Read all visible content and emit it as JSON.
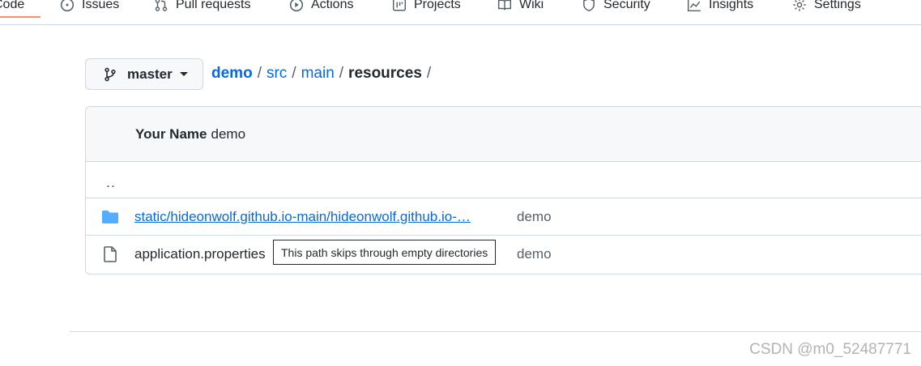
{
  "tabs": [
    {
      "label": "Code",
      "icon": "code-icon",
      "selected": true
    },
    {
      "label": "Issues",
      "icon": "issue-icon"
    },
    {
      "label": "Pull requests",
      "icon": "pull-request-icon"
    },
    {
      "label": "Actions",
      "icon": "play-icon"
    },
    {
      "label": "Projects",
      "icon": "project-icon"
    },
    {
      "label": "Wiki",
      "icon": "book-icon"
    },
    {
      "label": "Security",
      "icon": "shield-icon"
    },
    {
      "label": "Insights",
      "icon": "graph-icon"
    },
    {
      "label": "Settings",
      "icon": "gear-icon"
    }
  ],
  "branch": {
    "name": "master",
    "icon": "git-branch-icon"
  },
  "breadcrumb": {
    "repo": "demo",
    "dirs": [
      "src",
      "main"
    ],
    "current": "resources",
    "separator": "/"
  },
  "latest_commit": {
    "author": "Your Name",
    "message": "demo"
  },
  "parent_link": "..",
  "files": [
    {
      "type": "folder",
      "name": "static/hideonwolf.github.io-main/hideonwolf.github.io-…",
      "message": "demo",
      "icon": "folder-icon"
    },
    {
      "type": "file",
      "name": "application.properties",
      "message": "demo",
      "icon": "file-icon"
    }
  ],
  "tooltip": "This path skips through empty directories",
  "watermark": "CSDN @m0_52487771",
  "colors": {
    "link": "#0969da",
    "folder": "#54aeff",
    "selected_tab_underline": "#fd8c73",
    "border": "#d0d7de"
  }
}
